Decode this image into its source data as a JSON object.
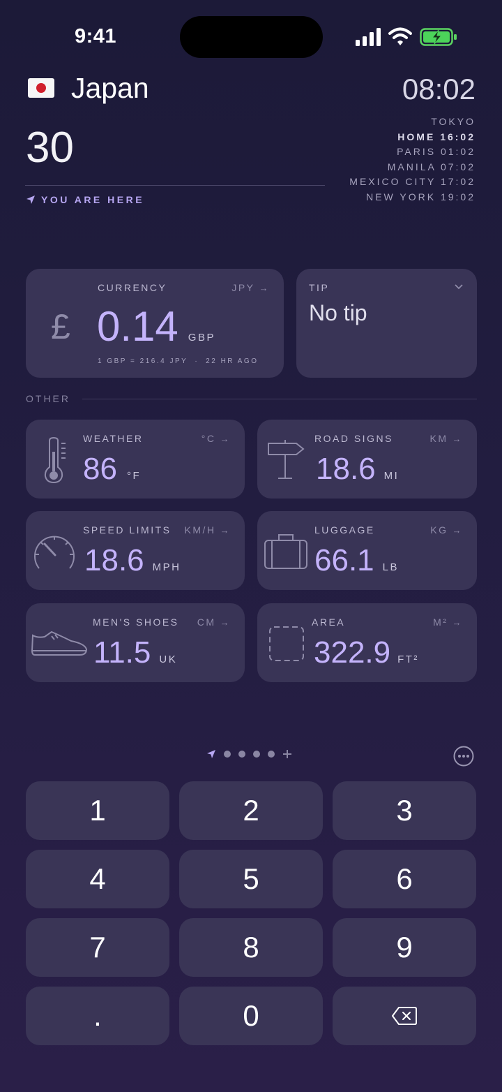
{
  "status": {
    "time": "9:41"
  },
  "header": {
    "country": "Japan",
    "amount": "30",
    "location_label": "YOU ARE HERE",
    "local_time": "08:02",
    "city": "TOKYO",
    "zones": [
      {
        "name": "HOME",
        "time": "16:02"
      },
      {
        "name": "PARIS",
        "time": "01:02"
      },
      {
        "name": "MANILA",
        "time": "07:02"
      },
      {
        "name": "MEXICO CITY",
        "time": "17:02"
      },
      {
        "name": "NEW YORK",
        "time": "19:02"
      }
    ]
  },
  "currency": {
    "label": "CURRENCY",
    "from_unit": "JPY",
    "value": "0.14",
    "to_unit": "GBP",
    "rate": "1 GBP = 216.4 JPY",
    "separator": "·",
    "updated": "22 HR AGO",
    "symbol": "£"
  },
  "tip": {
    "label": "TIP",
    "value": "No tip"
  },
  "other_label": "OTHER",
  "converters": [
    {
      "label": "WEATHER",
      "from_unit": "°C",
      "value": "86",
      "to_unit": "°F",
      "icon": "thermometer-icon"
    },
    {
      "label": "ROAD SIGNS",
      "from_unit": "KM",
      "value": "18.6",
      "to_unit": "MI",
      "icon": "signpost-icon"
    },
    {
      "label": "SPEED LIMITS",
      "from_unit": "KM/H",
      "value": "18.6",
      "to_unit": "MPH",
      "icon": "speedometer-icon"
    },
    {
      "label": "LUGGAGE",
      "from_unit": "KG",
      "value": "66.1",
      "to_unit": "LB",
      "icon": "suitcase-icon"
    },
    {
      "label": "MEN'S SHOES",
      "from_unit": "CM",
      "value": "11.5",
      "to_unit": "UK",
      "icon": "shoe-icon"
    },
    {
      "label": "AREA",
      "from_unit": "M²",
      "value": "322.9",
      "to_unit": "FT²",
      "icon": "area-icon"
    }
  ],
  "keypad": [
    "1",
    "2",
    "3",
    "4",
    "5",
    "6",
    "7",
    "8",
    "9",
    ".",
    "0"
  ],
  "arrow": "→"
}
